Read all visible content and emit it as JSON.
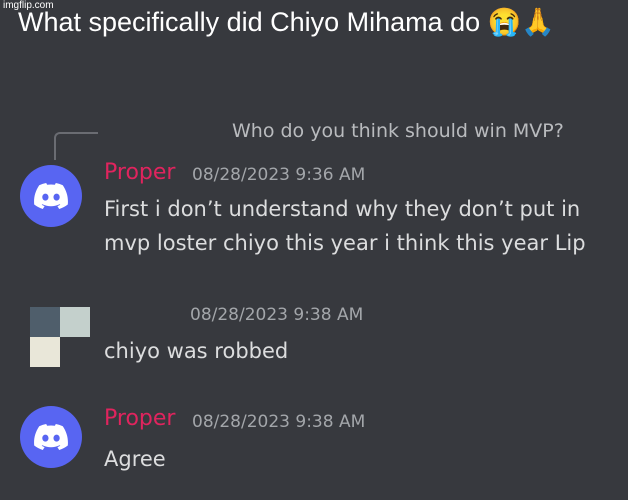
{
  "caption": "What specifically did Chiyo Mihama do 😭🙏",
  "watermark": "imgflip.com",
  "reply_preview": "Who do you think should win MVP?",
  "messages": [
    {
      "author": "Proper",
      "timestamp": "08/28/2023 9:36 AM",
      "lines": [
        "First i don’t understand why they don’t put in",
        "mvp loster chiyo this year i think this year Lip"
      ]
    },
    {
      "author": "",
      "timestamp": "08/28/2023 9:38 AM",
      "lines": [
        "chiyo was robbed"
      ]
    },
    {
      "author": "Proper",
      "timestamp": "08/28/2023 9:38 AM",
      "lines": [
        "Agree"
      ]
    }
  ],
  "colors": {
    "background": "#37393e",
    "username": "#e0245e",
    "discord_blurple": "#5865f2"
  },
  "icons": [
    "discord-logo-icon",
    "pixel-avatar"
  ]
}
